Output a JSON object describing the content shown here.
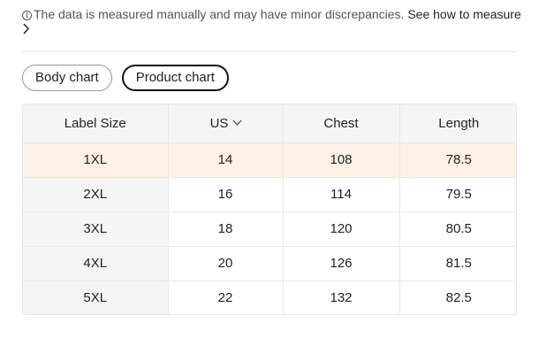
{
  "notice": {
    "icon": "info-icon",
    "text": "The data is measured manually and may have minor discrepancies.",
    "link": "See how to measure",
    "chevron": "›"
  },
  "tabs": [
    {
      "label": "Body chart",
      "active": false
    },
    {
      "label": "Product chart",
      "active": true
    }
  ],
  "table": {
    "headers": [
      "Label Size",
      "US",
      "Chest",
      "Length"
    ],
    "rows": [
      [
        "1XL",
        "14",
        "108",
        "78.5"
      ],
      [
        "2XL",
        "16",
        "114",
        "79.5"
      ],
      [
        "3XL",
        "18",
        "120",
        "80.5"
      ],
      [
        "4XL",
        "20",
        "126",
        "81.5"
      ],
      [
        "5XL",
        "22",
        "132",
        "82.5"
      ]
    ],
    "highlight_color": "#fdf0e4"
  }
}
